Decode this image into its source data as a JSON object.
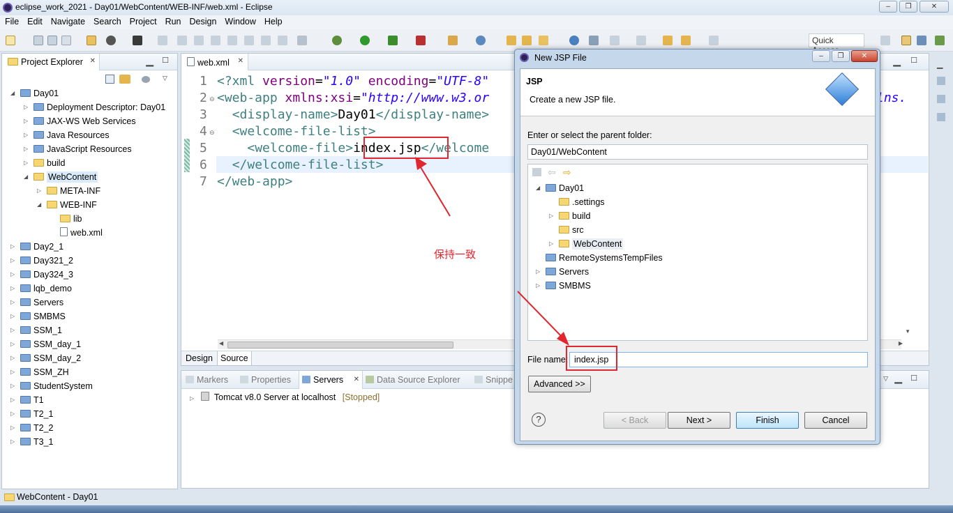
{
  "window": {
    "title": "eclipse_work_2021 - Day01/WebContent/WEB-INF/web.xml - Eclipse"
  },
  "menu": [
    "File",
    "Edit",
    "Navigate",
    "Search",
    "Project",
    "Run",
    "Design",
    "Window",
    "Help"
  ],
  "toolbar": {
    "quick_access": "Quick Access"
  },
  "project_explorer": {
    "title": "Project Explorer",
    "items": [
      {
        "label": "Day01",
        "indent": 0,
        "icon": "project-icon",
        "twisty": "open"
      },
      {
        "label": "Deployment Descriptor: Day01",
        "indent": 1,
        "icon": "descriptor-icon",
        "twisty": "closed"
      },
      {
        "label": "JAX-WS Web Services",
        "indent": 1,
        "icon": "webservice-icon",
        "twisty": "closed"
      },
      {
        "label": "Java Resources",
        "indent": 1,
        "icon": "java-resources-icon",
        "twisty": "closed"
      },
      {
        "label": "JavaScript Resources",
        "indent": 1,
        "icon": "js-resources-icon",
        "twisty": "closed"
      },
      {
        "label": "build",
        "indent": 1,
        "icon": "folder-icon",
        "twisty": "closed"
      },
      {
        "label": "WebContent",
        "indent": 1,
        "icon": "folder-icon",
        "twisty": "open",
        "selected": true
      },
      {
        "label": "META-INF",
        "indent": 2,
        "icon": "folder-icon",
        "twisty": "closed"
      },
      {
        "label": "WEB-INF",
        "indent": 2,
        "icon": "folder-icon",
        "twisty": "open"
      },
      {
        "label": "lib",
        "indent": 3,
        "icon": "folder-icon",
        "twisty": "none"
      },
      {
        "label": "web.xml",
        "indent": 3,
        "icon": "xml-file-icon",
        "twisty": "none"
      },
      {
        "label": "Day2_1",
        "indent": 0,
        "icon": "project-icon",
        "twisty": "closed"
      },
      {
        "label": "Day321_2",
        "indent": 0,
        "icon": "project-icon",
        "twisty": "closed"
      },
      {
        "label": "Day324_3",
        "indent": 0,
        "icon": "project-icon",
        "twisty": "closed"
      },
      {
        "label": "lqb_demo",
        "indent": 0,
        "icon": "project-icon",
        "twisty": "closed"
      },
      {
        "label": "Servers",
        "indent": 0,
        "icon": "project-icon",
        "twisty": "closed"
      },
      {
        "label": "SMBMS",
        "indent": 0,
        "icon": "project-icon",
        "twisty": "closed"
      },
      {
        "label": "SSM_1",
        "indent": 0,
        "icon": "project-icon",
        "twisty": "closed"
      },
      {
        "label": "SSM_day_1",
        "indent": 0,
        "icon": "project-icon",
        "twisty": "closed"
      },
      {
        "label": "SSM_day_2",
        "indent": 0,
        "icon": "project-icon",
        "twisty": "closed"
      },
      {
        "label": "SSM_ZH",
        "indent": 0,
        "icon": "project-icon",
        "twisty": "closed"
      },
      {
        "label": "StudentSystem",
        "indent": 0,
        "icon": "project-icon",
        "twisty": "closed"
      },
      {
        "label": "T1",
        "indent": 0,
        "icon": "project-icon",
        "twisty": "closed"
      },
      {
        "label": "T2_1",
        "indent": 0,
        "icon": "project-icon",
        "twisty": "closed"
      },
      {
        "label": "T2_2",
        "indent": 0,
        "icon": "project-icon",
        "twisty": "closed"
      },
      {
        "label": "T3_1",
        "indent": 0,
        "icon": "project-icon",
        "twisty": "closed"
      }
    ]
  },
  "editor": {
    "tab": "web.xml",
    "line_numbers": [
      "1",
      "2",
      "3",
      "4",
      "5",
      "6",
      "7"
    ],
    "bottom_tabs": [
      "Design",
      "Source"
    ]
  },
  "bottom_panel": {
    "tabs": [
      "Markers",
      "Properties",
      "Servers",
      "Data Source Explorer",
      "Snippe"
    ],
    "server": "Tomcat v8.0 Server at localhost",
    "server_state": "[Stopped]"
  },
  "annotation": {
    "text": "保持一致"
  },
  "dialog": {
    "title": "New JSP File",
    "heading": "JSP",
    "description": "Create a new JSP file.",
    "parent_label": "Enter or select the parent folder:",
    "parent_value": "Day01/WebContent",
    "tree": [
      {
        "label": "Day01",
        "indent": 0,
        "twisty": "open",
        "icon": "project-icon"
      },
      {
        "label": ".settings",
        "indent": 1,
        "twisty": "none",
        "icon": "folder-icon"
      },
      {
        "label": "build",
        "indent": 1,
        "twisty": "closed",
        "icon": "folder-icon"
      },
      {
        "label": "src",
        "indent": 1,
        "twisty": "none",
        "icon": "folder-icon"
      },
      {
        "label": "WebContent",
        "indent": 1,
        "twisty": "closed",
        "icon": "folder-icon",
        "selected": true
      },
      {
        "label": "RemoteSystemsTempFiles",
        "indent": 0,
        "twisty": "none",
        "icon": "project-icon"
      },
      {
        "label": "Servers",
        "indent": 0,
        "twisty": "closed",
        "icon": "project-icon"
      },
      {
        "label": "SMBMS",
        "indent": 0,
        "twisty": "closed",
        "icon": "project-icon"
      }
    ],
    "file_name_label": "File name:",
    "file_name_value": "index.jsp",
    "advanced": "Advanced >>",
    "help": "?",
    "buttons": {
      "back": "< Back",
      "next": "Next >",
      "finish": "Finish",
      "cancel": "Cancel"
    }
  },
  "status_bar": {
    "text": "WebContent - Day01"
  },
  "colors": {
    "accent": "#3399ff",
    "annotation": "#e0262e",
    "selection": "#cce8ff"
  }
}
